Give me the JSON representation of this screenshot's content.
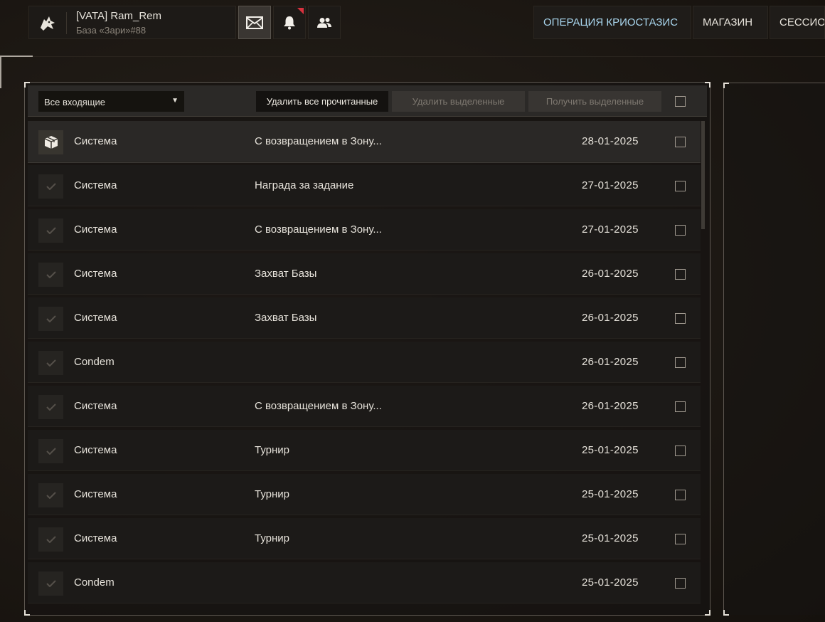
{
  "header": {
    "player_name": "[VATA] Ram_Rem",
    "base_name": "База «Зари»#88",
    "buttons": {
      "mail_icon": "envelope-icon",
      "notifications_icon": "bell-icon",
      "friends_icon": "people-icon"
    },
    "nav": [
      "ОПЕРАЦИЯ КРИОСТАЗИС",
      "МАГАЗИН",
      "СЕССИОН"
    ],
    "accent_color": "#a9d6ee",
    "notification_color": "#d8323e"
  },
  "mail": {
    "filter": "Все входящие",
    "delete_read_label": "Удалить все прочитанные",
    "delete_selected_label": "Удалить выделенные",
    "receive_selected_label": "Получить выделенные",
    "messages": [
      {
        "icon": "package-icon",
        "sender": "Система",
        "subject": "С возвращением в Зону...",
        "date": "28-01-2025"
      },
      {
        "icon": "check-icon",
        "sender": "Система",
        "subject": "Награда за задание",
        "date": "27-01-2025"
      },
      {
        "icon": "check-icon",
        "sender": "Система",
        "subject": "С возвращением в Зону...",
        "date": "27-01-2025"
      },
      {
        "icon": "check-icon",
        "sender": "Система",
        "subject": "Захват Базы",
        "date": "26-01-2025"
      },
      {
        "icon": "check-icon",
        "sender": "Система",
        "subject": "Захват Базы",
        "date": "26-01-2025"
      },
      {
        "icon": "check-icon",
        "sender": "Condem",
        "subject": "",
        "date": "26-01-2025"
      },
      {
        "icon": "check-icon",
        "sender": "Система",
        "subject": "С возвращением в Зону...",
        "date": "26-01-2025"
      },
      {
        "icon": "check-icon",
        "sender": "Система",
        "subject": "Турнир",
        "date": "25-01-2025"
      },
      {
        "icon": "check-icon",
        "sender": "Система",
        "subject": "Турнир",
        "date": "25-01-2025"
      },
      {
        "icon": "check-icon",
        "sender": "Система",
        "subject": "Турнир",
        "date": "25-01-2025"
      },
      {
        "icon": "check-icon",
        "sender": "Condem",
        "subject": "",
        "date": "25-01-2025"
      }
    ]
  }
}
